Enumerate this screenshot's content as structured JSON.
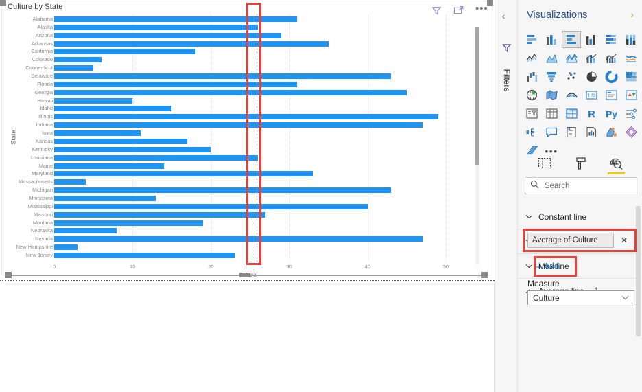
{
  "visual": {
    "title": "Culture by State",
    "header_icons": [
      {
        "name": "filter-icon",
        "label": "Filters"
      },
      {
        "name": "focus-mode-icon",
        "label": "Focus mode"
      },
      {
        "name": "more-options-icon",
        "label": "More options"
      }
    ]
  },
  "chart_data": {
    "type": "bar",
    "orientation": "horizontal",
    "title": "Culture by State",
    "xlabel": "Culture",
    "ylabel": "State",
    "xlim": [
      0,
      50
    ],
    "xticks": [
      0,
      10,
      20,
      30,
      40,
      50
    ],
    "grid": true,
    "legend": "none",
    "bar_color": "#1f94f2",
    "average_line": {
      "label": "Average of Culture",
      "value": 25.8,
      "color": "#e08a95",
      "style": "dashed"
    },
    "categories": [
      "Alabama",
      "Alaska",
      "Arizona",
      "Arkansas",
      "California",
      "Colorado",
      "Connecticut",
      "Delaware",
      "Florida",
      "Georgia",
      "Hawaii",
      "Idaho",
      "Illinois",
      "Indiana",
      "Iowa",
      "Kansas",
      "Kentucky",
      "Louisiana",
      "Maine",
      "Maryland",
      "Massachusetts",
      "Michigan",
      "Minnesota",
      "Mississippi",
      "Missouri",
      "Montana",
      "Nebraska",
      "Nevada",
      "New Hampshire",
      "New Jersey"
    ],
    "values": [
      31,
      26,
      29,
      35,
      18,
      6,
      5,
      43,
      31,
      45,
      10,
      15,
      49,
      47,
      11,
      17,
      20,
      26,
      14,
      33,
      4,
      43,
      13,
      40,
      27,
      19,
      8,
      47,
      3,
      23
    ]
  },
  "filters_pane": {
    "label": "Filters",
    "collapse_label": "‹"
  },
  "visualizations_pane": {
    "title": "Visualizations",
    "expand_label": "›",
    "gallery": [
      {
        "name": "stacked-bar-chart-icon"
      },
      {
        "name": "stacked-column-chart-icon"
      },
      {
        "name": "clustered-bar-chart-icon"
      },
      {
        "name": "clustered-column-chart-icon"
      },
      {
        "name": "100-percent-stacked-bar-chart-icon"
      },
      {
        "name": "100-percent-stacked-column-chart-icon"
      },
      {
        "name": "line-chart-icon"
      },
      {
        "name": "area-chart-icon"
      },
      {
        "name": "stacked-area-chart-icon"
      },
      {
        "name": "line-and-stacked-column-chart-icon"
      },
      {
        "name": "line-and-clustered-column-chart-icon"
      },
      {
        "name": "ribbon-chart-icon"
      },
      {
        "name": "waterfall-chart-icon"
      },
      {
        "name": "funnel-chart-icon"
      },
      {
        "name": "scatter-chart-icon"
      },
      {
        "name": "pie-chart-icon"
      },
      {
        "name": "donut-chart-icon"
      },
      {
        "name": "treemap-icon"
      },
      {
        "name": "map-icon"
      },
      {
        "name": "filled-map-icon"
      },
      {
        "name": "arcgis-map-icon"
      },
      {
        "name": "card-icon"
      },
      {
        "name": "multi-row-card-icon"
      },
      {
        "name": "kpi-icon"
      },
      {
        "name": "slicer-icon"
      },
      {
        "name": "table-icon"
      },
      {
        "name": "matrix-icon"
      },
      {
        "name": "r-script-visual-icon"
      },
      {
        "name": "python-visual-icon"
      },
      {
        "name": "key-influencers-icon"
      },
      {
        "name": "decomposition-tree-icon"
      },
      {
        "name": "q-and-a-icon"
      },
      {
        "name": "smart-narrative-icon"
      },
      {
        "name": "paginated-report-icon"
      },
      {
        "name": "power-apps-icon"
      },
      {
        "name": "power-automate-icon"
      },
      {
        "name": "get-more-visuals-icon"
      },
      {
        "name": "more-visuals-ellipsis-icon"
      }
    ],
    "selected_gallery_index": 2,
    "tabs": [
      {
        "name": "fields-tab",
        "label": "Fields"
      },
      {
        "name": "format-tab",
        "label": "Format"
      },
      {
        "name": "analytics-tab",
        "label": "Analytics"
      }
    ],
    "active_tab_index": 2,
    "search": {
      "placeholder": "Search"
    },
    "analytics": {
      "sections": [
        {
          "label": "Constant line",
          "expanded": false,
          "count": ""
        },
        {
          "label": "Min line",
          "expanded": false,
          "count": ""
        },
        {
          "label": "Max line",
          "expanded": false,
          "count": ""
        }
      ],
      "average_line": {
        "label": "Average line",
        "count": "1",
        "expanded": true,
        "chip_label": "Average of Culture",
        "chip_remove": "✕",
        "add_label": "Add",
        "add_plus": "+",
        "measure_label": "Measure",
        "measure_value": "Culture"
      }
    }
  },
  "colors": {
    "accent_blue": "#1f94f2",
    "brand_blue": "#2b579a",
    "highlight_red": "#e8403a",
    "tab_underline_yellow": "#f2c811",
    "link_blue": "#0f6cbd"
  }
}
